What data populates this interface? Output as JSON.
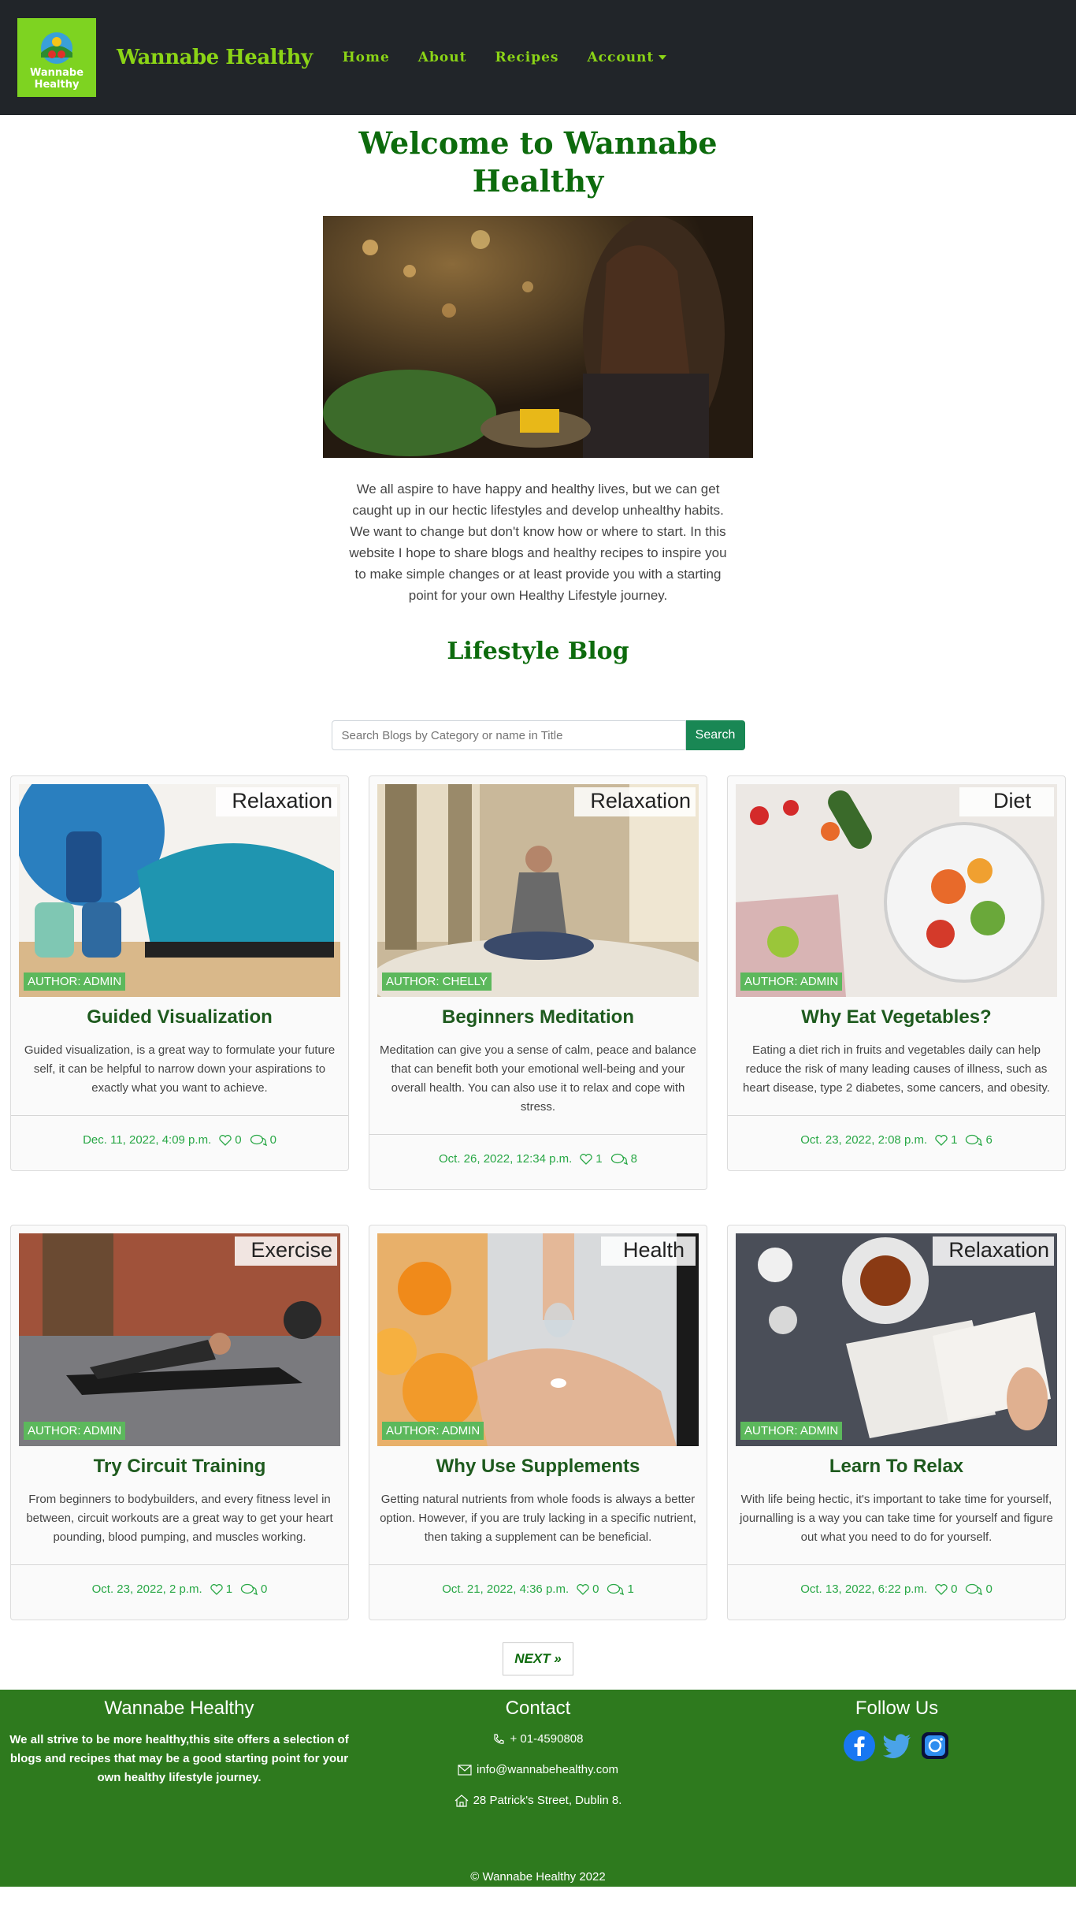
{
  "nav": {
    "logo_text_line1": "Wannabe",
    "logo_text_line2": "Healthy",
    "brand": "Wannabe Healthy",
    "links": [
      "Home",
      "About",
      "Recipes",
      "Account"
    ]
  },
  "main": {
    "welcome": "Welcome to Wannabe Healthy",
    "intro": "We all aspire to have happy and healthy lives, but we can get caught up in our hectic lifestyles and develop unhealthy habits. We want to change but don't know how or where to start. In this website I hope to share blogs and healthy recipes to inspire you to make simple changes or at least provide you with a starting point for your own Healthy Lifestyle journey.",
    "blog_heading": "Lifestyle Blog"
  },
  "search": {
    "placeholder": "Search Blogs by Category or name in Title",
    "button": "Search"
  },
  "posts": [
    {
      "category": "Relaxation",
      "author": "AUTHOR: ADMIN",
      "title": "Guided Visualization",
      "desc": "Guided visualization, is a great way to formulate your future self, it can be helpful to narrow down your aspirations to exactly what you want to achieve.",
      "date": "Dec. 11, 2022, 4:09 p.m.",
      "likes": "0",
      "comments": "0"
    },
    {
      "category": "Relaxation",
      "author": "AUTHOR: CHELLY",
      "title": "Beginners Meditation",
      "desc": "Meditation can give you a sense of calm, peace and balance that can benefit both your emotional well-being and your overall health. You can also use it to relax and cope with stress.",
      "date": "Oct. 26, 2022, 12:34 p.m.",
      "likes": "1",
      "comments": "8"
    },
    {
      "category": "Diet",
      "author": "AUTHOR: ADMIN",
      "title": "Why Eat Vegetables?",
      "desc": "Eating a diet rich in fruits and vegetables daily can help reduce the risk of many leading causes of illness, such as heart disease, type 2 diabetes, some cancers, and obesity.",
      "date": "Oct. 23, 2022, 2:08 p.m.",
      "likes": "1",
      "comments": "6"
    },
    {
      "category": "Exercise",
      "author": "AUTHOR: ADMIN",
      "title": "Try Circuit Training",
      "desc": "From beginners to bodybuilders, and every fitness level in between, circuit workouts are a great way to get your heart pounding, blood pumping, and muscles working.",
      "date": "Oct. 23, 2022, 2 p.m.",
      "likes": "1",
      "comments": "0"
    },
    {
      "category": "Health",
      "author": "AUTHOR: ADMIN",
      "title": "Why Use Supplements",
      "desc": "Getting natural nutrients from whole foods is always a better option. However, if you are truly lacking in a specific nutrient, then taking a supplement can be beneficial.",
      "date": "Oct. 21, 2022, 4:36 p.m.",
      "likes": "0",
      "comments": "1"
    },
    {
      "category": "Relaxation",
      "author": "AUTHOR: ADMIN",
      "title": "Learn To Relax",
      "desc": "With life being hectic, it's important to take time for yourself, journalling is a way you can take time for yourself and figure out what you need to do for yourself.",
      "date": "Oct. 13, 2022, 6:22 p.m.",
      "likes": "0",
      "comments": "0"
    }
  ],
  "pagination": {
    "next": "NEXT »"
  },
  "footer": {
    "about_title": "Wannabe Healthy",
    "about_text": "We all strive to be more healthy,this site offers a selection of blogs and recipes that may be a good starting point for your own healthy lifestyle journey.",
    "contact_title": "Contact",
    "phone": "+ 01-4590808",
    "email": "info@wannabehealthy.com",
    "address": "28 Patrick's Street, Dublin 8.",
    "follow_title": "Follow Us",
    "copyright": "© Wannabe Healthy 2022"
  },
  "colors": {
    "nav_bg": "#212529",
    "accent_green": "#8bd416",
    "heading_green": "#0d6b0d",
    "footer_bg": "#2e7a1e",
    "button_green": "#198754"
  },
  "icons": [
    "heart-icon",
    "comment-icon",
    "phone-icon",
    "mail-icon",
    "home-icon",
    "facebook-icon",
    "twitter-icon",
    "instagram-icon"
  ]
}
